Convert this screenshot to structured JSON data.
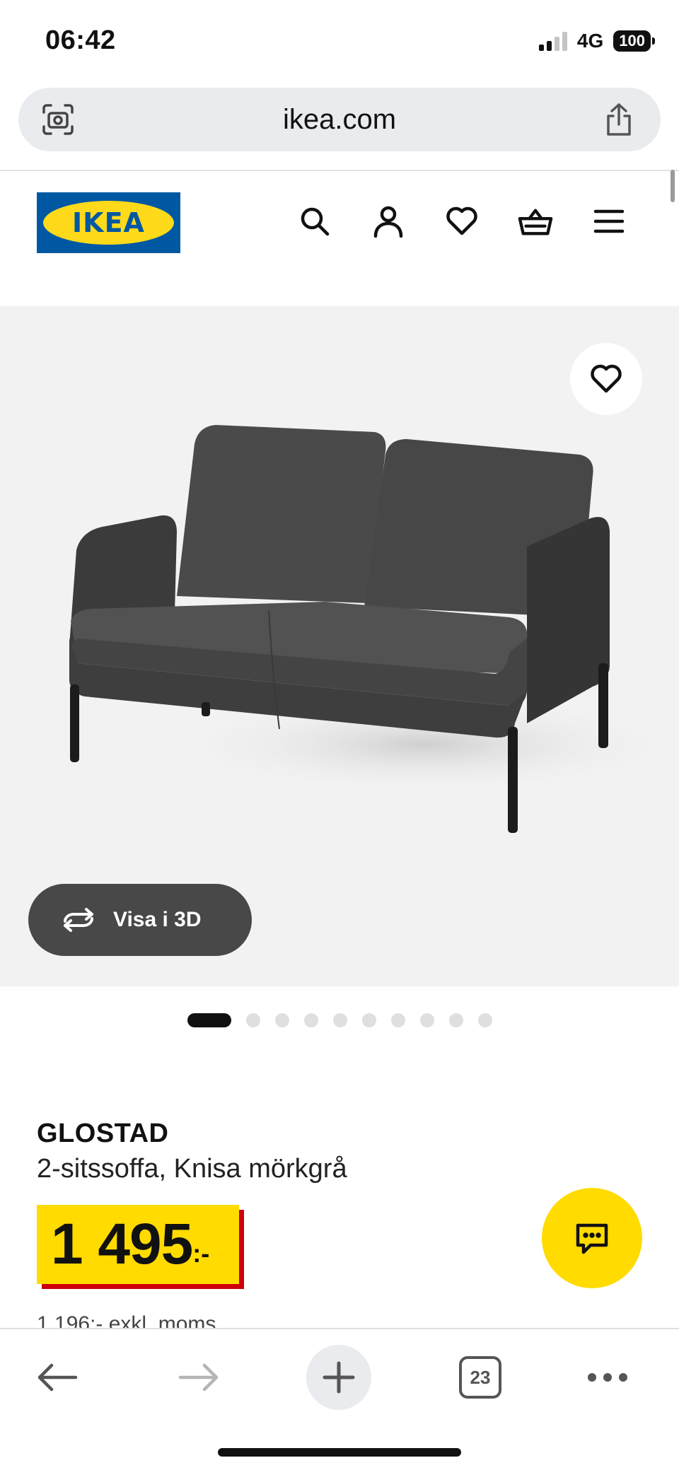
{
  "status_bar": {
    "time": "06:42",
    "network": "4G",
    "battery": "100"
  },
  "browser": {
    "url": "ikea.com",
    "open_tabs": "23"
  },
  "header": {
    "logo_text": "IKEA"
  },
  "product": {
    "view_3d_label": "Visa i 3D",
    "image_count": 10,
    "active_image": 1,
    "name": "GLOSTAD",
    "description": "2-sitssoffa, Knisa mörkgrå",
    "price": "1 495",
    "price_suffix": ":-",
    "price_ex_vat": "1 196:- exkl. moms"
  },
  "colors": {
    "ikea_blue": "#0058a3",
    "ikea_yellow": "#ffdb00",
    "price_shadow_red": "#cc0008",
    "image_bg": "#f2f2f2"
  },
  "icons": {
    "header": [
      "search-icon",
      "account-icon",
      "heart-icon",
      "basket-icon",
      "menu-icon"
    ],
    "toolbar": [
      "back-arrow-icon",
      "forward-arrow-icon",
      "plus-icon",
      "tabs-icon",
      "more-icon"
    ]
  }
}
